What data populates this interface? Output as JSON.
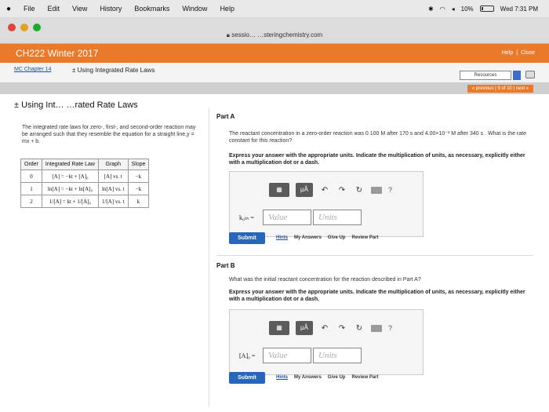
{
  "menubar": {
    "items": [
      "File",
      "Edit",
      "View",
      "History",
      "Bookmarks",
      "Window",
      "Help"
    ],
    "battery": "10%",
    "clock": "Wed 7:31 PM"
  },
  "browser": {
    "url": "sessio… …steringchemistry.com"
  },
  "header": {
    "course": "CH222 Winter 2017",
    "help": "Help",
    "close": "Close"
  },
  "breadcrumb": {
    "chapter": "MC Chapter 14",
    "assignment": "± Using Integrated Rate Laws",
    "resources": "Resources"
  },
  "pager": {
    "text": "« previous  |  9 of 10  |  next »"
  },
  "left": {
    "title": "± Using Int… …rated Rate Laws",
    "intro": "The integrated rate laws for zero-, first-, and second-order reaction may be arranged such that they resemble the equation for a straight line,y = mx + b.",
    "table": {
      "headers": [
        "Order",
        "Integrated Rate Law",
        "Graph",
        "Slope"
      ],
      "rows": [
        [
          "0",
          "[A] = −kt + [A]₀",
          "[A] vs. t",
          "−k"
        ],
        [
          "1",
          "ln[A] = −kt + ln[A]₀",
          "ln[A] vs. t",
          "−k"
        ],
        [
          "2",
          "1/[A] = kt + 1/[A]₀",
          "1/[A] vs. t",
          "k"
        ]
      ]
    }
  },
  "partA": {
    "label": "Part A",
    "question": "The reactant concentration in a zero-order reaction was 0.100 M after 170 s and 4.00×10⁻² M after 340 s . What is the rate constant for this reaction?",
    "instruction": "Express your answer with the appropriate units. Indicate the multiplication of units, as necessary, explicitly either with a multiplication dot or a dash.",
    "variable": "k₀ₜₕ =",
    "value_placeholder": "Value",
    "units_placeholder": "Units",
    "submit": "Submit",
    "hints": "Hints",
    "my_answers": "My Answers",
    "give_up": "Give Up",
    "review": "Review Part"
  },
  "partB": {
    "label": "Part B",
    "question": "What was the initial reactant concentration for the reaction described in Part A?",
    "instruction": "Express your answer with the appropriate units. Indicate the multiplication of units, as necessary, explicitly either with a multiplication dot or a dash.",
    "variable": "[A]₀ =",
    "value_placeholder": "Value",
    "units_placeholder": "Units",
    "submit": "Submit",
    "hints": "Hints",
    "my_answers": "My Answers",
    "give_up": "Give Up",
    "review": "Review Part"
  },
  "toolbar": {
    "mu": "μÅ",
    "help": "?"
  },
  "colors": {
    "orange": "#e87a2a",
    "submit": "#2766bb"
  }
}
